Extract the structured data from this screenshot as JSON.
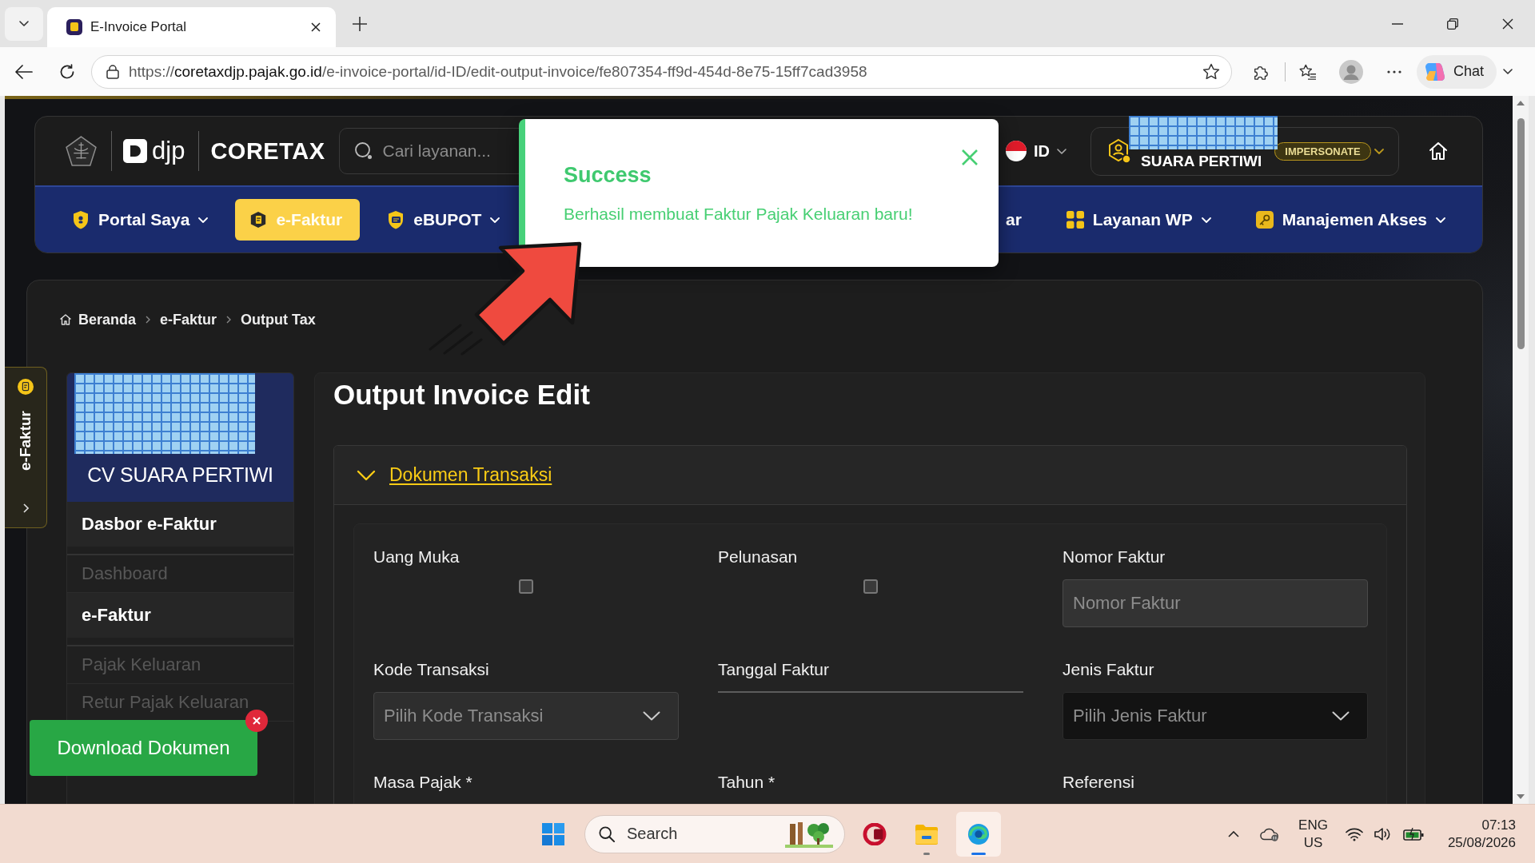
{
  "browser": {
    "tabs": [
      {
        "title": "E-Invoice Portal",
        "selected": true
      }
    ],
    "address": {
      "scheme": "https://",
      "host": "coretaxdjp.pajak.go.id",
      "path": "/e-invoice-portal/id-ID/edit-output-invoice/fe807354-ff9d-454d-8e75-15ff7cad3958"
    },
    "chat_button": "Chat"
  },
  "header": {
    "logo_text": "djp",
    "brand": "CORETAX",
    "search": {
      "placeholder": "Cari layanan..."
    },
    "language": "ID",
    "user": {
      "name": "SUARA PERTIWI",
      "badge": "IMPERSONATE"
    }
  },
  "nav": [
    {
      "label": "Portal Saya",
      "selected": false,
      "dropdown": true
    },
    {
      "label": "e-Faktur",
      "selected": true,
      "dropdown": false
    },
    {
      "label": "eBUPOT",
      "selected": false,
      "dropdown": true
    },
    {
      "label": "ar",
      "selected": false,
      "dropdown": false
    },
    {
      "label": "Layanan WP",
      "selected": false,
      "dropdown": true
    },
    {
      "label": "Manajemen Akses",
      "selected": false,
      "dropdown": true
    }
  ],
  "toast": {
    "title": "Success",
    "message": "Berhasil membuat Faktur Pajak Keluaran baru!"
  },
  "breadcrumb": [
    "Beranda",
    "e-Faktur",
    "Output Tax"
  ],
  "side_tab": {
    "label": "e-Faktur"
  },
  "sidebar": {
    "company": "CV SUARA PERTIWI",
    "sections": [
      {
        "title": "Dasbor e-Faktur",
        "items": [
          {
            "label": "Dashboard"
          }
        ]
      },
      {
        "title": "e-Faktur",
        "items": [
          {
            "label": "Pajak Keluaran"
          },
          {
            "label": "Retur Pajak Keluaran"
          }
        ]
      }
    ]
  },
  "download_button": "Download Dokumen",
  "form": {
    "title": "Output Invoice Edit",
    "section": {
      "title": "Dokumen Transaksi",
      "expanded": true
    },
    "fields": [
      {
        "kind": "checkbox",
        "label": "Uang Muka",
        "checked": false
      },
      {
        "kind": "checkbox",
        "label": "Pelunasan",
        "checked": false
      },
      {
        "kind": "text",
        "label": "Nomor Faktur",
        "placeholder": "Nomor Faktur",
        "disabled": true
      },
      {
        "kind": "select",
        "label": "Kode Transaksi",
        "placeholder": "Pilih Kode Transaksi",
        "disabled": true
      },
      {
        "kind": "date",
        "label": "Tanggal Faktur"
      },
      {
        "kind": "select",
        "label": "Jenis Faktur",
        "placeholder": "Pilih Jenis Faktur",
        "disabled": false
      },
      {
        "kind": "label",
        "label": "Masa Pajak *"
      },
      {
        "kind": "label",
        "label": "Tahun *"
      },
      {
        "kind": "label",
        "label": "Referensi"
      }
    ]
  },
  "taskbar": {
    "search": {
      "placeholder": "Search"
    },
    "apps": [
      {
        "running": false,
        "active": false
      },
      {
        "running": true,
        "active": false
      },
      {
        "running": true,
        "active": true
      }
    ],
    "tray": {
      "language": "ENG",
      "region": "US",
      "time": "07:13",
      "date": "25/08/2026"
    }
  }
}
